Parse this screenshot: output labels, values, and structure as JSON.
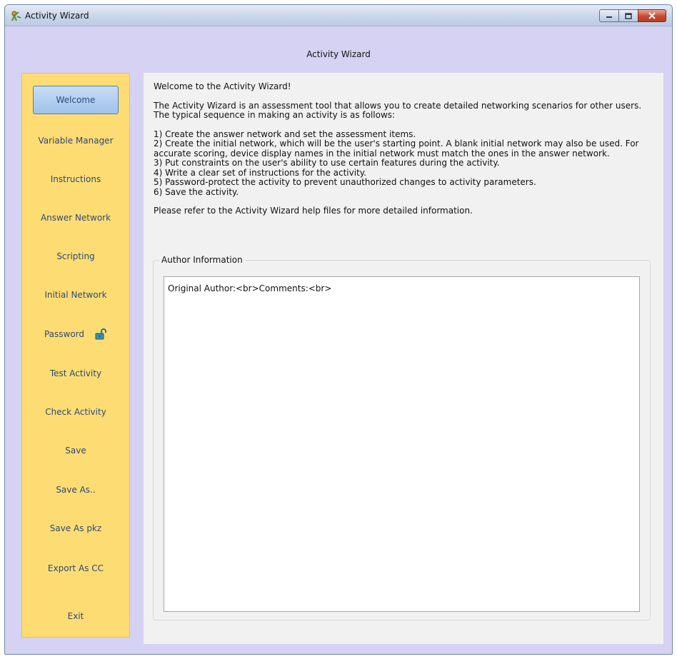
{
  "window": {
    "title": "Activity Wizard"
  },
  "header": {
    "title": "Activity Wizard"
  },
  "sidebar": {
    "items": [
      {
        "label": "Welcome",
        "selected": true
      },
      {
        "label": "Variable Manager"
      },
      {
        "label": "Instructions"
      },
      {
        "label": "Answer Network"
      },
      {
        "label": "Scripting"
      },
      {
        "label": "Initial Network"
      },
      {
        "label": "Password",
        "icon": "unlocked-padlock-icon"
      },
      {
        "label": "Test Activity"
      },
      {
        "label": "Check Activity"
      },
      {
        "label": "Save"
      },
      {
        "label": "Save As.."
      },
      {
        "label": "Save As pkz"
      },
      {
        "label": "Export As CC"
      },
      {
        "label": "Exit"
      }
    ]
  },
  "main": {
    "welcome_heading": "Welcome to the Activity Wizard!",
    "description": "The Activity Wizard is an assessment tool that allows you to create detailed networking scenarios for other users. The typical sequence in making an activity is as follows:",
    "steps": [
      "1) Create the answer network and set the assessment items.",
      "2) Create the initial network, which will be the user's starting point. A blank initial network may also be used. For accurate scoring, device display names in the initial network must match the ones in the answer network.",
      "3) Put constraints on the user's ability to use certain features during the activity.",
      "4) Write a clear set of instructions for the activity.",
      "5) Password-protect the activity to prevent unauthorized changes to activity parameters.",
      "6) Save the activity."
    ],
    "help_note": "Please refer to the Activity Wizard help files for more detailed information.",
    "author_group_label": "Author Information",
    "author_text": "Original Author:<br>Comments:<br>"
  },
  "colors": {
    "window_bg": "#d6d2f4",
    "sidebar_bg": "#fddd73",
    "nav_text": "#2e4878",
    "selected_bg": "#9fc2ec",
    "close_button": "#c84a31"
  }
}
